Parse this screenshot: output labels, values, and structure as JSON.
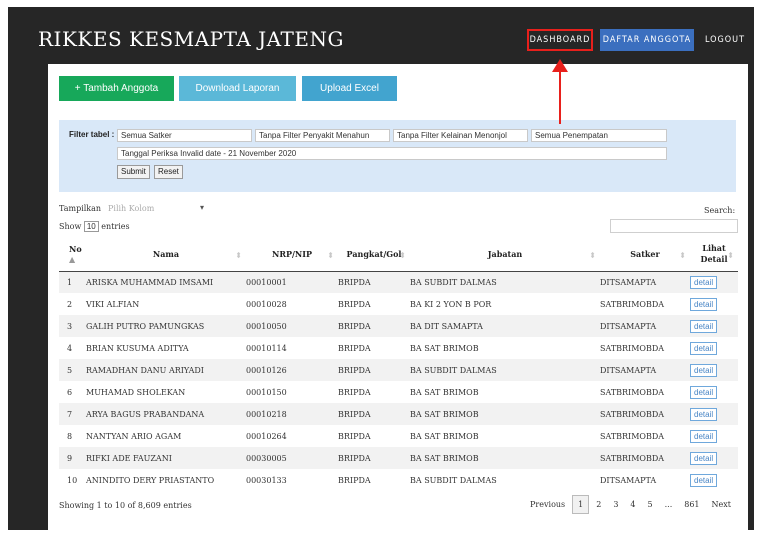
{
  "header": {
    "title": "RIKKES KESMAPTA JATENG",
    "nav": [
      "DASHBOARD",
      "DAFTAR ANGGOTA",
      "LOGOUT"
    ]
  },
  "actions": {
    "tambah": "+ Tambah Anggota",
    "download": "Download Laporan",
    "upload": "Upload Excel"
  },
  "filter": {
    "label": "Filter tabel :",
    "satker": "Semua Satker",
    "penyakit": "Tanpa Filter Penyakit Menahun",
    "kelainan": "Tanpa Filter Kelainan Menonjol",
    "penempatan": "Semua Penempatan",
    "date": "Tanggal Periksa Invalid date - 21 November 2020",
    "submit": "Submit",
    "reset": "Reset"
  },
  "controls": {
    "tampilkan": "Tampilkan",
    "pilih_kolom": "Pilih Kolom",
    "show": "Show",
    "page_len": "10",
    "entries": "entries",
    "search": "Search:"
  },
  "table": {
    "columns": [
      "No",
      "Nama",
      "NRP/NIP",
      "Pangkat/Gol",
      "Jabatan",
      "Satker",
      "Lihat Detail"
    ],
    "rows": [
      {
        "no": "1",
        "nama": "ARISKA MUHAMMAD IMSAMI",
        "nrp": "00010001",
        "pangkat": "BRIPDA",
        "jabatan": "BA SUBDIT DALMAS",
        "satker": "DITSAMAPTA",
        "detail": "detail"
      },
      {
        "no": "2",
        "nama": "VIKI ALFIAN",
        "nrp": "00010028",
        "pangkat": "BRIPDA",
        "jabatan": "BA KI 2 YON B POR",
        "satker": "SATBRIMOBDA",
        "detail": "detail"
      },
      {
        "no": "3",
        "nama": "GALIH PUTRO PAMUNGKAS",
        "nrp": "00010050",
        "pangkat": "BRIPDA",
        "jabatan": "BA DIT SAMAPTA",
        "satker": "DITSAMAPTA",
        "detail": "detail"
      },
      {
        "no": "4",
        "nama": "BRIAN KUSUMA ADITYA",
        "nrp": "00010114",
        "pangkat": "BRIPDA",
        "jabatan": "BA SAT BRIMOB",
        "satker": "SATBRIMOBDA",
        "detail": "detail"
      },
      {
        "no": "5",
        "nama": "RAMADHAN DANU ARIYADI",
        "nrp": "00010126",
        "pangkat": "BRIPDA",
        "jabatan": "BA SUBDIT DALMAS",
        "satker": "DITSAMAPTA",
        "detail": "detail"
      },
      {
        "no": "6",
        "nama": "MUHAMAD SHOLEKAN",
        "nrp": "00010150",
        "pangkat": "BRIPDA",
        "jabatan": "BA SAT BRIMOB",
        "satker": "SATBRIMOBDA",
        "detail": "detail"
      },
      {
        "no": "7",
        "nama": "ARYA BAGUS PRABANDANA",
        "nrp": "00010218",
        "pangkat": "BRIPDA",
        "jabatan": "BA SAT BRIMOB",
        "satker": "SATBRIMOBDA",
        "detail": "detail"
      },
      {
        "no": "8",
        "nama": "NANTYAN ARIO AGAM",
        "nrp": "00010264",
        "pangkat": "BRIPDA",
        "jabatan": "BA SAT BRIMOB",
        "satker": "SATBRIMOBDA",
        "detail": "detail"
      },
      {
        "no": "9",
        "nama": "RIFKI ADE FAUZANI",
        "nrp": "00030005",
        "pangkat": "BRIPDA",
        "jabatan": "BA SAT BRIMOB",
        "satker": "SATBRIMOBDA",
        "detail": "detail"
      },
      {
        "no": "10",
        "nama": "ANINDITO DERY PRIASTANTO",
        "nrp": "00030133",
        "pangkat": "BRIPDA",
        "jabatan": "BA SUBDIT DALMAS",
        "satker": "DITSAMAPTA",
        "detail": "detail"
      }
    ]
  },
  "footer": {
    "info": "Showing 1 to 10 of 8,609 entries",
    "pagination": [
      "Previous",
      "1",
      "2",
      "3",
      "4",
      "5",
      "...",
      "861",
      "Next"
    ]
  },
  "colors": {
    "frame": "#262626",
    "annotation": "#e8201c",
    "nav_active": "#3b6fbf",
    "btn_green": "#17a85a",
    "btn_blue": "#5bb8d8",
    "filter_bg": "#d9e8f8"
  }
}
